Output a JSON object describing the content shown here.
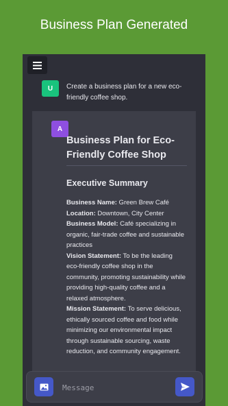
{
  "header": {
    "title": "Business Plan Generated"
  },
  "chat": {
    "user": {
      "avatar_letter": "U",
      "message": "Create a business plan for a new eco-friendly coffee shop."
    },
    "assistant": {
      "avatar_letter": "A",
      "plan_title": "Business Plan for Eco-Friendly Coffee Shop",
      "section_title": "Executive Summary",
      "fields": [
        {
          "label": "Business Name:",
          "value": " Green Brew Café"
        },
        {
          "label": "Location:",
          "value": " Downtown, City Center"
        },
        {
          "label": "Business Model:",
          "value": " Café specializing in organic, fair-trade coffee and sustainable practices"
        },
        {
          "label": "Vision Statement:",
          "value": " To be the leading eco-friendly coffee shop in the community, promoting sustainability while providing high-quality coffee and a relaxed atmosphere."
        },
        {
          "label": "Mission Statement:",
          "value": " To serve delicious, ethically sourced coffee and food while minimizing our environmental impact through sustainable sourcing, waste reduction, and community engagement."
        }
      ]
    }
  },
  "composer": {
    "placeholder": "Message"
  },
  "icons": {
    "menu": "hamburger-menu-icon",
    "image": "image-icon",
    "send": "send-icon"
  },
  "colors": {
    "background": "#5b9a35",
    "panel": "#2e2f38",
    "card": "#3d3e48",
    "user_avatar": "#19c37d",
    "assistant_avatar": "#8e4fe0",
    "button": "#4558c8"
  }
}
